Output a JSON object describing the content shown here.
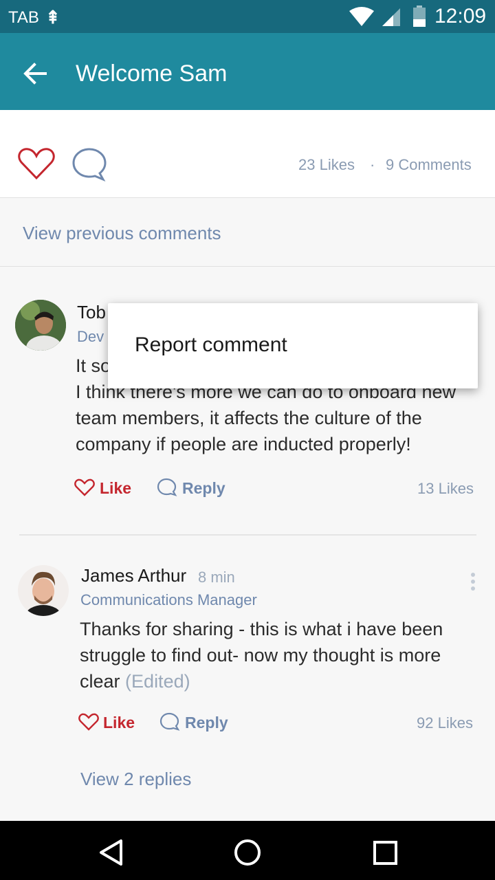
{
  "status_bar": {
    "carrier": "TAB",
    "time": "12:09",
    "icons": [
      "antenna-icon",
      "wifi-icon",
      "signal-icon",
      "battery-icon"
    ]
  },
  "app_bar": {
    "title": "Welcome Sam",
    "back_icon": "back-arrow-icon"
  },
  "post": {
    "likes": "23 Likes",
    "separator": "·",
    "comments": "9 Comments"
  },
  "view_previous": "View previous comments",
  "comments": [
    {
      "name": "Tob",
      "role": "Dev",
      "text_first": "It so",
      "text_rest": "I think there's more we can do to onboard new team members, it affects the culture of the company if people are inducted properly!",
      "like_label": "Like",
      "reply_label": "Reply",
      "likes": "13 Likes"
    },
    {
      "name": "James Arthur",
      "time": "8 min",
      "role": "Communications Manager",
      "text": "Thanks for sharing - this is what i have been struggle to find out- now my thought is more clear",
      "edited": "(Edited)",
      "like_label": "Like",
      "reply_label": "Reply",
      "likes": "92 Likes"
    }
  ],
  "view_replies": "View 2 replies",
  "context_menu": {
    "items": [
      "Report comment"
    ]
  },
  "colors": {
    "status_bar": "#17697d",
    "app_bar": "#1f8a9e",
    "like_red": "#c4262e",
    "link_blue": "#6f88ad"
  }
}
